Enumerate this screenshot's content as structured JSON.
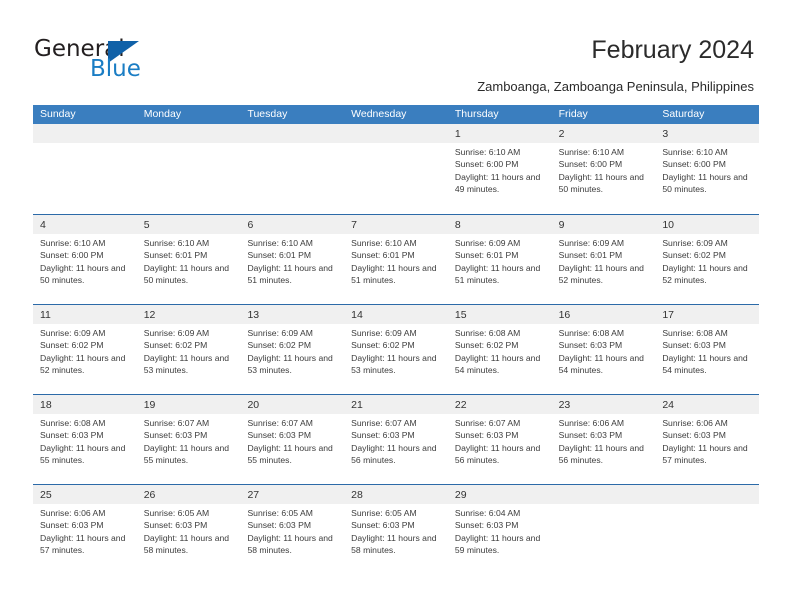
{
  "brand": {
    "name_part1": "General",
    "name_part2": "Blue",
    "logo_icon": "triangle-flag-icon",
    "accent_color": "#1a7dc4",
    "logo_triangle_color": "#1061a8"
  },
  "header": {
    "title": "February 2024",
    "subtitle": "Zamboanga, Zamboanga Peninsula, Philippines"
  },
  "theme": {
    "header_bar_color": "#3a7ebf",
    "row_divider_color": "#2c6aa8",
    "daynum_band_color": "#f0f0f0",
    "text_color": "#3c3c3c"
  },
  "calendar": {
    "weekdays": [
      "Sunday",
      "Monday",
      "Tuesday",
      "Wednesday",
      "Thursday",
      "Friday",
      "Saturday"
    ],
    "weeks": [
      [
        {
          "day": "",
          "sunrise": "",
          "sunset": "",
          "daylight": ""
        },
        {
          "day": "",
          "sunrise": "",
          "sunset": "",
          "daylight": ""
        },
        {
          "day": "",
          "sunrise": "",
          "sunset": "",
          "daylight": ""
        },
        {
          "day": "",
          "sunrise": "",
          "sunset": "",
          "daylight": ""
        },
        {
          "day": "1",
          "sunrise": "Sunrise: 6:10 AM",
          "sunset": "Sunset: 6:00 PM",
          "daylight": "Daylight: 11 hours and 49 minutes."
        },
        {
          "day": "2",
          "sunrise": "Sunrise: 6:10 AM",
          "sunset": "Sunset: 6:00 PM",
          "daylight": "Daylight: 11 hours and 50 minutes."
        },
        {
          "day": "3",
          "sunrise": "Sunrise: 6:10 AM",
          "sunset": "Sunset: 6:00 PM",
          "daylight": "Daylight: 11 hours and 50 minutes."
        }
      ],
      [
        {
          "day": "4",
          "sunrise": "Sunrise: 6:10 AM",
          "sunset": "Sunset: 6:00 PM",
          "daylight": "Daylight: 11 hours and 50 minutes."
        },
        {
          "day": "5",
          "sunrise": "Sunrise: 6:10 AM",
          "sunset": "Sunset: 6:01 PM",
          "daylight": "Daylight: 11 hours and 50 minutes."
        },
        {
          "day": "6",
          "sunrise": "Sunrise: 6:10 AM",
          "sunset": "Sunset: 6:01 PM",
          "daylight": "Daylight: 11 hours and 51 minutes."
        },
        {
          "day": "7",
          "sunrise": "Sunrise: 6:10 AM",
          "sunset": "Sunset: 6:01 PM",
          "daylight": "Daylight: 11 hours and 51 minutes."
        },
        {
          "day": "8",
          "sunrise": "Sunrise: 6:09 AM",
          "sunset": "Sunset: 6:01 PM",
          "daylight": "Daylight: 11 hours and 51 minutes."
        },
        {
          "day": "9",
          "sunrise": "Sunrise: 6:09 AM",
          "sunset": "Sunset: 6:01 PM",
          "daylight": "Daylight: 11 hours and 52 minutes."
        },
        {
          "day": "10",
          "sunrise": "Sunrise: 6:09 AM",
          "sunset": "Sunset: 6:02 PM",
          "daylight": "Daylight: 11 hours and 52 minutes."
        }
      ],
      [
        {
          "day": "11",
          "sunrise": "Sunrise: 6:09 AM",
          "sunset": "Sunset: 6:02 PM",
          "daylight": "Daylight: 11 hours and 52 minutes."
        },
        {
          "day": "12",
          "sunrise": "Sunrise: 6:09 AM",
          "sunset": "Sunset: 6:02 PM",
          "daylight": "Daylight: 11 hours and 53 minutes."
        },
        {
          "day": "13",
          "sunrise": "Sunrise: 6:09 AM",
          "sunset": "Sunset: 6:02 PM",
          "daylight": "Daylight: 11 hours and 53 minutes."
        },
        {
          "day": "14",
          "sunrise": "Sunrise: 6:09 AM",
          "sunset": "Sunset: 6:02 PM",
          "daylight": "Daylight: 11 hours and 53 minutes."
        },
        {
          "day": "15",
          "sunrise": "Sunrise: 6:08 AM",
          "sunset": "Sunset: 6:02 PM",
          "daylight": "Daylight: 11 hours and 54 minutes."
        },
        {
          "day": "16",
          "sunrise": "Sunrise: 6:08 AM",
          "sunset": "Sunset: 6:03 PM",
          "daylight": "Daylight: 11 hours and 54 minutes."
        },
        {
          "day": "17",
          "sunrise": "Sunrise: 6:08 AM",
          "sunset": "Sunset: 6:03 PM",
          "daylight": "Daylight: 11 hours and 54 minutes."
        }
      ],
      [
        {
          "day": "18",
          "sunrise": "Sunrise: 6:08 AM",
          "sunset": "Sunset: 6:03 PM",
          "daylight": "Daylight: 11 hours and 55 minutes."
        },
        {
          "day": "19",
          "sunrise": "Sunrise: 6:07 AM",
          "sunset": "Sunset: 6:03 PM",
          "daylight": "Daylight: 11 hours and 55 minutes."
        },
        {
          "day": "20",
          "sunrise": "Sunrise: 6:07 AM",
          "sunset": "Sunset: 6:03 PM",
          "daylight": "Daylight: 11 hours and 55 minutes."
        },
        {
          "day": "21",
          "sunrise": "Sunrise: 6:07 AM",
          "sunset": "Sunset: 6:03 PM",
          "daylight": "Daylight: 11 hours and 56 minutes."
        },
        {
          "day": "22",
          "sunrise": "Sunrise: 6:07 AM",
          "sunset": "Sunset: 6:03 PM",
          "daylight": "Daylight: 11 hours and 56 minutes."
        },
        {
          "day": "23",
          "sunrise": "Sunrise: 6:06 AM",
          "sunset": "Sunset: 6:03 PM",
          "daylight": "Daylight: 11 hours and 56 minutes."
        },
        {
          "day": "24",
          "sunrise": "Sunrise: 6:06 AM",
          "sunset": "Sunset: 6:03 PM",
          "daylight": "Daylight: 11 hours and 57 minutes."
        }
      ],
      [
        {
          "day": "25",
          "sunrise": "Sunrise: 6:06 AM",
          "sunset": "Sunset: 6:03 PM",
          "daylight": "Daylight: 11 hours and 57 minutes."
        },
        {
          "day": "26",
          "sunrise": "Sunrise: 6:05 AM",
          "sunset": "Sunset: 6:03 PM",
          "daylight": "Daylight: 11 hours and 58 minutes."
        },
        {
          "day": "27",
          "sunrise": "Sunrise: 6:05 AM",
          "sunset": "Sunset: 6:03 PM",
          "daylight": "Daylight: 11 hours and 58 minutes."
        },
        {
          "day": "28",
          "sunrise": "Sunrise: 6:05 AM",
          "sunset": "Sunset: 6:03 PM",
          "daylight": "Daylight: 11 hours and 58 minutes."
        },
        {
          "day": "29",
          "sunrise": "Sunrise: 6:04 AM",
          "sunset": "Sunset: 6:03 PM",
          "daylight": "Daylight: 11 hours and 59 minutes."
        },
        {
          "day": "",
          "sunrise": "",
          "sunset": "",
          "daylight": ""
        },
        {
          "day": "",
          "sunrise": "",
          "sunset": "",
          "daylight": ""
        }
      ]
    ]
  }
}
